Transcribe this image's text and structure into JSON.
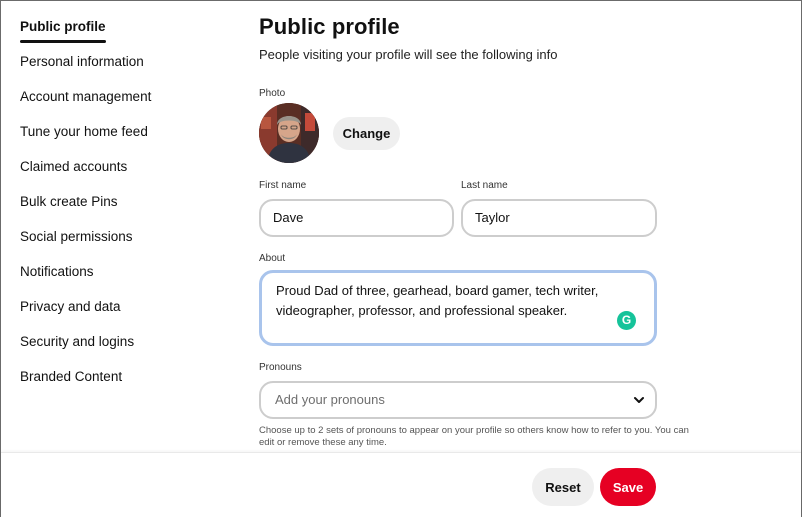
{
  "sidebar": {
    "items": [
      {
        "label": "Public profile",
        "active": true
      },
      {
        "label": "Personal information"
      },
      {
        "label": "Account management"
      },
      {
        "label": "Tune your home feed"
      },
      {
        "label": "Claimed accounts"
      },
      {
        "label": "Bulk create Pins"
      },
      {
        "label": "Social permissions"
      },
      {
        "label": "Notifications"
      },
      {
        "label": "Privacy and data"
      },
      {
        "label": "Security and logins"
      },
      {
        "label": "Branded Content"
      }
    ]
  },
  "main": {
    "title": "Public profile",
    "subtitle": "People visiting your profile will see the following info",
    "photo": {
      "label": "Photo",
      "change_label": "Change"
    },
    "first_name": {
      "label": "First name",
      "value": "Dave"
    },
    "last_name": {
      "label": "Last name",
      "value": "Taylor"
    },
    "about": {
      "label": "About",
      "value": "Proud Dad of three, gearhead, board gamer, tech writer, videographer, professor, and professional speaker.",
      "assistant_icon_glyph": "G"
    },
    "pronouns": {
      "label": "Pronouns",
      "placeholder": "Add your pronouns",
      "helper": "Choose up to 2 sets of pronouns to appear on your profile so others know how to refer to you. You can edit or remove these any time."
    }
  },
  "footer": {
    "reset_label": "Reset",
    "save_label": "Save"
  },
  "colors": {
    "save": "#e60023",
    "focus_ring": "#a9c4ec",
    "grammarly": "#15c39a"
  }
}
